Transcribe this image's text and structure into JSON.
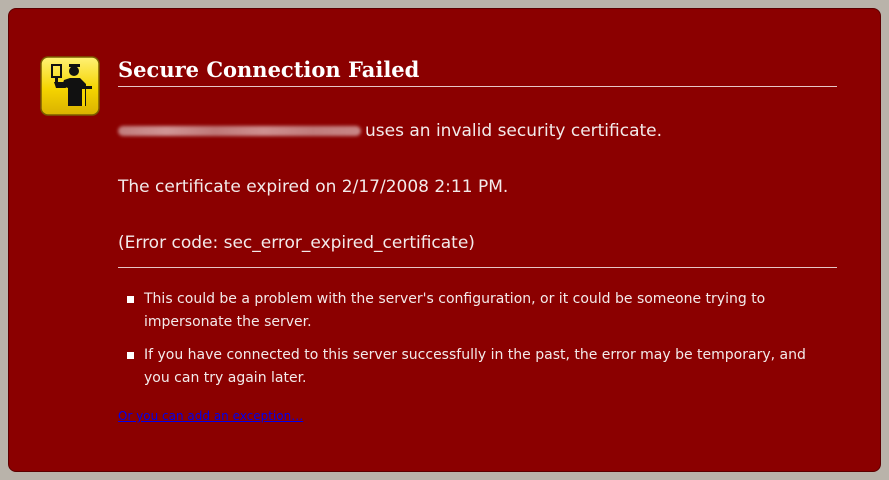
{
  "error_page": {
    "title": "Secure Connection Failed",
    "host_suffix": "uses an invalid security certificate.",
    "expiry_message": "The certificate expired on 2/17/2008 2:11 PM.",
    "error_code": "(Error code: sec_error_expired_certificate)",
    "bullets": [
      "This could be a problem with the server's configuration, or it could be someone trying to impersonate the server.",
      "If you have connected to this server successfully in the past, the error may be temporary, and you can try again later."
    ],
    "exception_link": "Or you can add an exception…",
    "icon": "security-warning-icon"
  },
  "colors": {
    "panel_background": "#8b0000",
    "page_background": "#b9b3aa",
    "icon_yellow": "#f5d400",
    "link": "#0000ee"
  }
}
